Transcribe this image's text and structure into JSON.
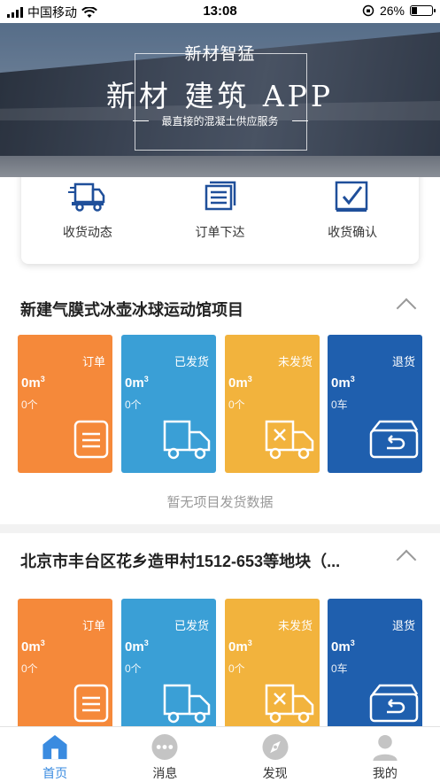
{
  "status_bar": {
    "carrier": "中国移动",
    "time": "13:08",
    "battery": "26%",
    "battery_level": 0.26
  },
  "banner": {
    "brand": "新材智猛",
    "title": "新材 建筑 APP",
    "tagline": "最直接的混凝土供应服务"
  },
  "quick_actions": [
    {
      "label": "收货动态",
      "icon": "delivery-truck-icon"
    },
    {
      "label": "订单下达",
      "icon": "order-list-icon"
    },
    {
      "label": "收货确认",
      "icon": "checkbox-confirm-icon"
    }
  ],
  "projects": [
    {
      "title": "新建气膜式冰壶冰球运动馆项目",
      "tiles": [
        {
          "label": "订单",
          "volume": "0m",
          "unit_sup": "3",
          "count": "0个",
          "icon": "document-icon",
          "color": "#f5893a"
        },
        {
          "label": "已发货",
          "volume": "0m",
          "unit_sup": "3",
          "count": "0个",
          "icon": "truck-icon",
          "color": "#3a9fd6"
        },
        {
          "label": "未发货",
          "volume": "0m",
          "unit_sup": "3",
          "count": "0个",
          "icon": "truck-cancel-icon",
          "color": "#f2b33d"
        },
        {
          "label": "退货",
          "volume": "0m",
          "unit_sup": "3",
          "count": "0车",
          "icon": "return-box-icon",
          "color": "#1f5fae"
        }
      ],
      "empty_tip": "暂无项目发货数据"
    },
    {
      "title": "北京市丰台区花乡造甲村1512-653等地块（...",
      "tiles": [
        {
          "label": "订单",
          "volume": "0m",
          "unit_sup": "3",
          "count": "0个",
          "icon": "document-icon",
          "color": "#f5893a"
        },
        {
          "label": "已发货",
          "volume": "0m",
          "unit_sup": "3",
          "count": "0个",
          "icon": "truck-icon",
          "color": "#3a9fd6"
        },
        {
          "label": "未发货",
          "volume": "0m",
          "unit_sup": "3",
          "count": "0个",
          "icon": "truck-cancel-icon",
          "color": "#f2b33d"
        },
        {
          "label": "退货",
          "volume": "0m",
          "unit_sup": "3",
          "count": "0车",
          "icon": "return-box-icon",
          "color": "#1f5fae"
        }
      ]
    }
  ],
  "tab_bar": [
    {
      "label": "首页",
      "icon": "home-icon",
      "active": true
    },
    {
      "label": "消息",
      "icon": "message-icon",
      "active": false
    },
    {
      "label": "发现",
      "icon": "compass-icon",
      "active": false
    },
    {
      "label": "我的",
      "icon": "user-icon",
      "active": false
    }
  ]
}
